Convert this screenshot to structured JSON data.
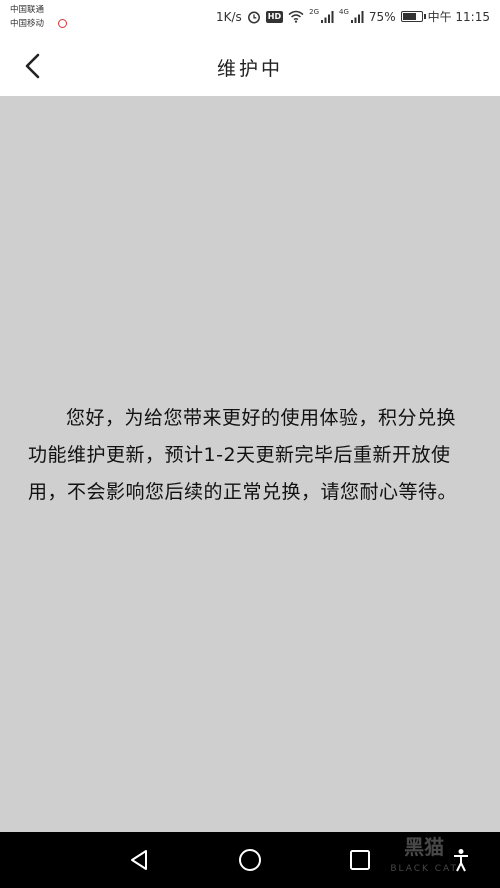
{
  "status_bar": {
    "carrier_1": "中国联通",
    "carrier_2": "中国移动",
    "net_speed": "1K/s",
    "hd_label": "HD",
    "net_2g": "2G",
    "net_4g": "4G",
    "battery": "75%",
    "battery_level": 0.75,
    "time": "中午 11:15"
  },
  "header": {
    "title": "维护中",
    "back_icon": "chevron-left-icon"
  },
  "main": {
    "notice": "您好，为给您带来更好的使用体验，积分兑换功能维护更新，预计1-2天更新完毕后重新开放使用，不会影响您后续的正常兑换，请您耐心等待。",
    "background_color": "#cfcfcf"
  },
  "bottom_nav": {
    "back_icon": "triangle-back-icon",
    "home_icon": "circle-home-icon",
    "recents_icon": "square-recents-icon",
    "watermark_cn": "黑猫",
    "watermark_en": "BLACK CAT"
  }
}
